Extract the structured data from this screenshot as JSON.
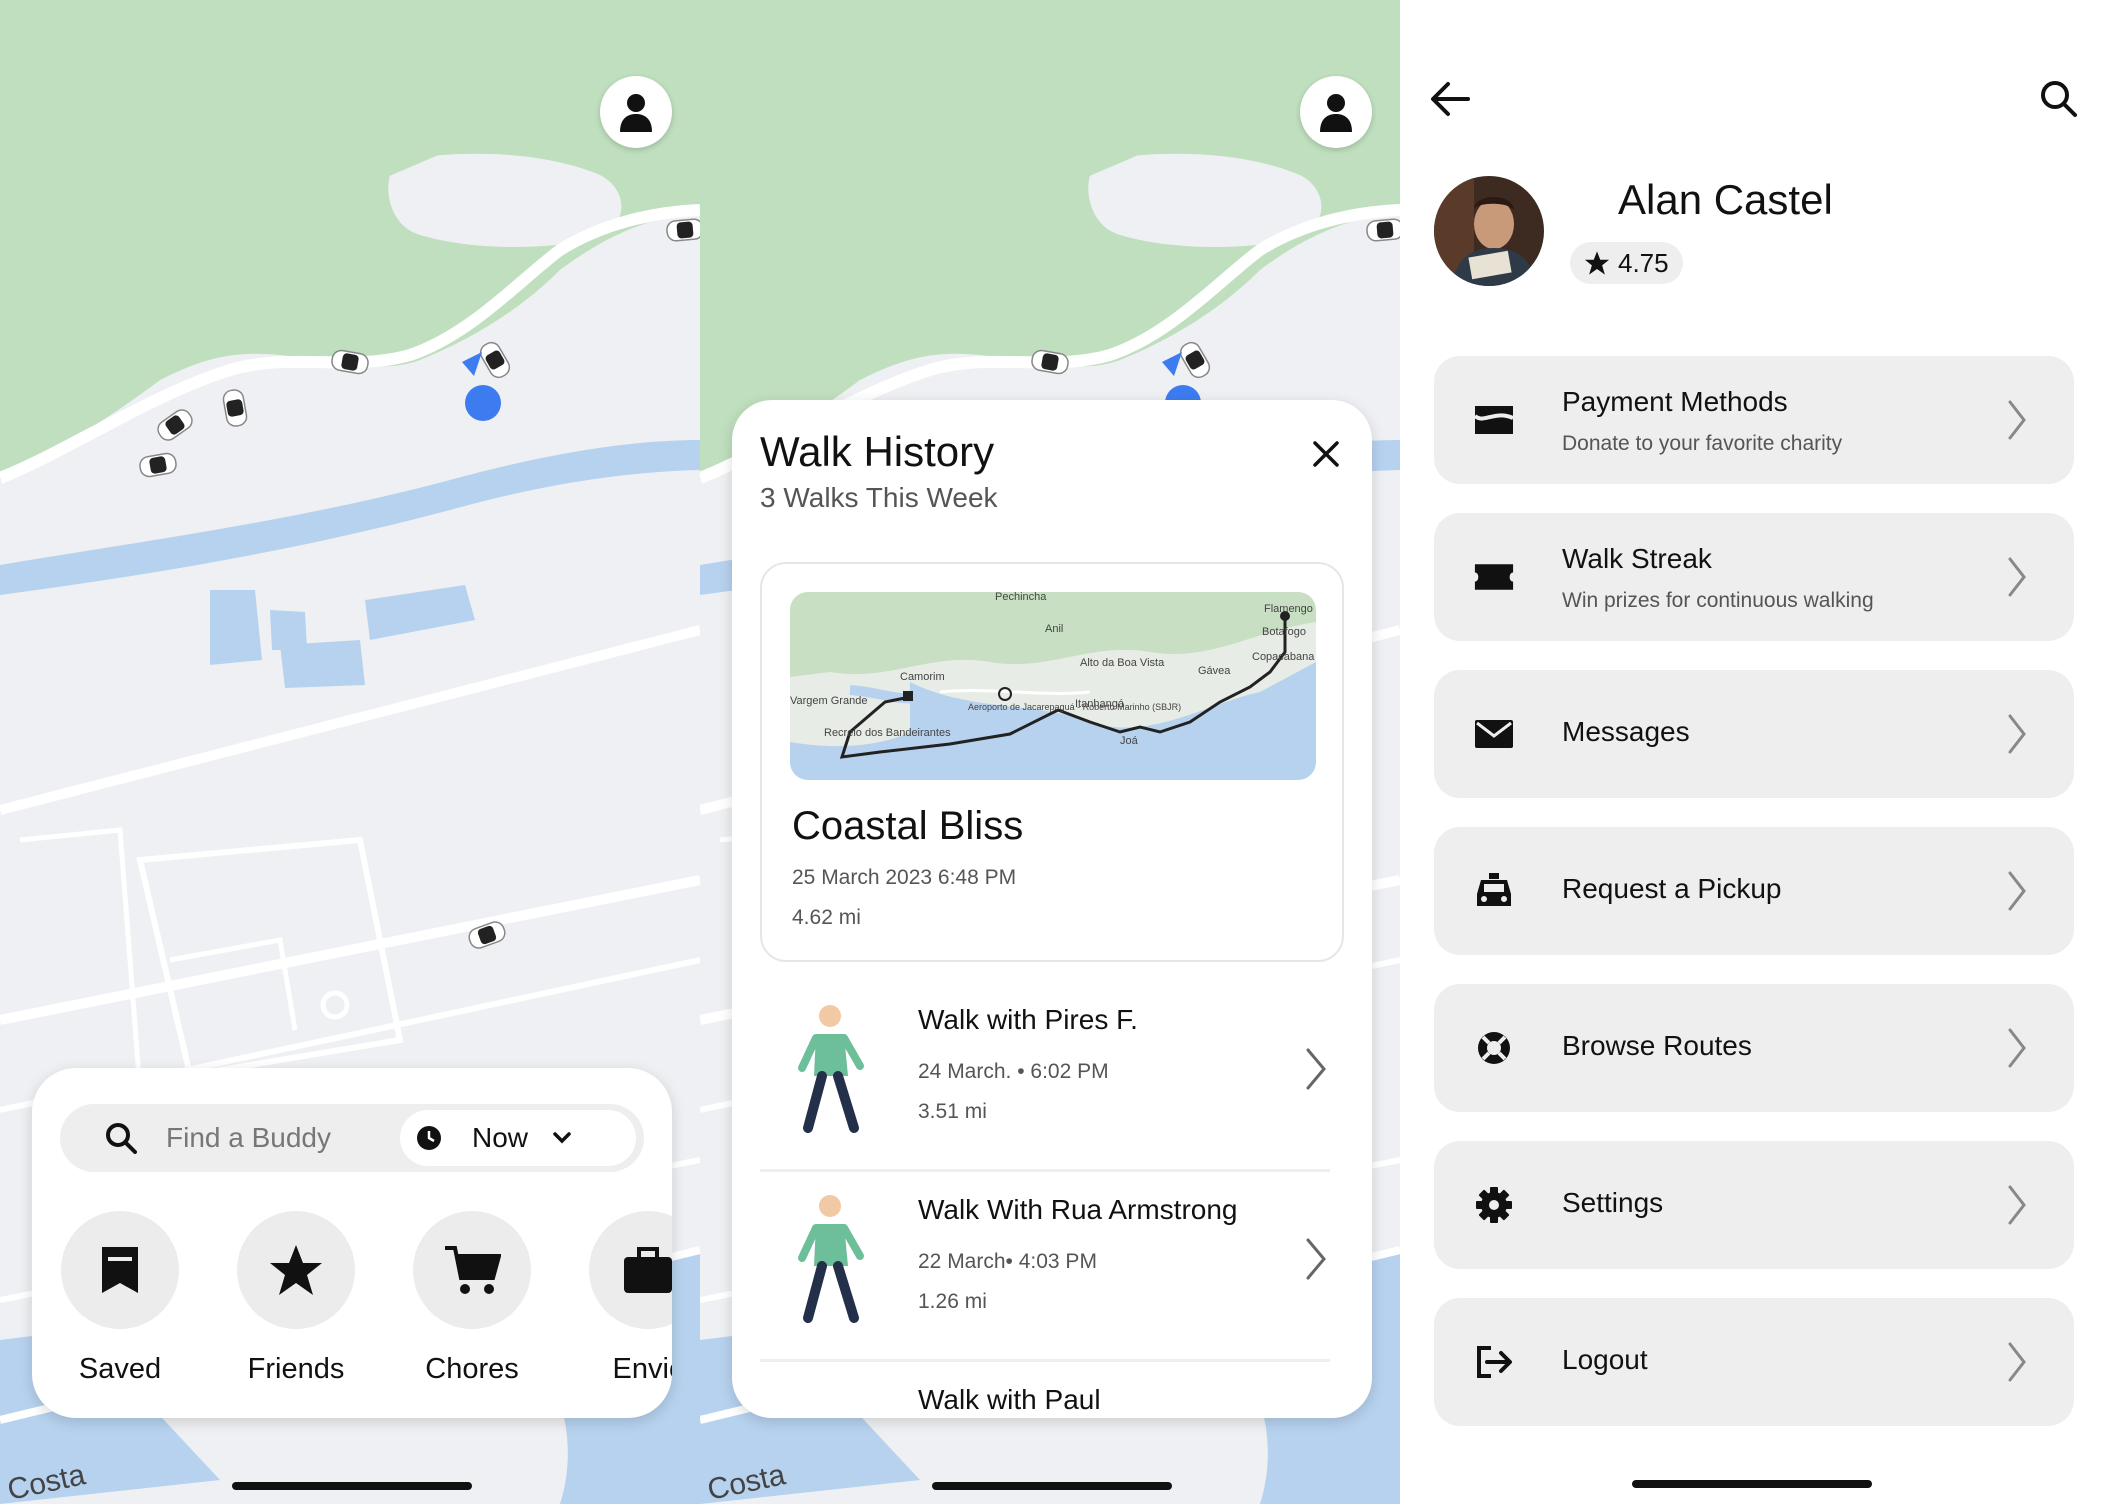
{
  "colors": {
    "map_green": "#bfdfbe",
    "map_land": "#eef0f3",
    "map_water": "#b7d2ef",
    "user_dot": "#3d7cf0",
    "card_gray": "#eeeeee"
  },
  "map": {
    "street_label": "Costa",
    "icons": {
      "profile": "person-icon",
      "car": "car-icon",
      "location": "location-dot-icon"
    }
  },
  "screen1": {
    "search_placeholder": "Find a Buddy",
    "time_label": "Now",
    "shortcuts": [
      {
        "label": "Saved",
        "icon": "bookmark-icon"
      },
      {
        "label": "Friends",
        "icon": "star-icon"
      },
      {
        "label": "Chores",
        "icon": "cart-icon"
      },
      {
        "label": "Envic",
        "icon": "briefcase-icon"
      }
    ]
  },
  "screen2": {
    "title": "Walk History",
    "subtitle": "3 Walks This Week",
    "featured": {
      "title": "Coastal Bliss",
      "date": "25 March 2023  6:48 PM",
      "distance": "4.62 mi",
      "map_labels": [
        "Pechincha",
        "Anil",
        "Alto da Boa Vista",
        "Camorim",
        "Aeroporto de Jacarepaguá - Roberto Marinho (SBJR)",
        "Itanhangá",
        "Joá",
        "Gávea",
        "Copacabana",
        "Botafogo",
        "Flamengo",
        "Recreio dos Bandeirantes",
        "Vargem Grande"
      ]
    },
    "walks": [
      {
        "title": "Walk with Pires F.",
        "date": "24 March. • 6:02 PM",
        "distance": "3.51 mi"
      },
      {
        "title": "Walk With Rua Armstrong",
        "date": "22 March• 4:03 PM",
        "distance": "1.26 mi"
      },
      {
        "title": "Walk with Paul",
        "date": "",
        "distance": ""
      }
    ]
  },
  "screen3": {
    "name": "Alan Castel",
    "rating": "4.75",
    "menu": [
      {
        "label": "Payment Methods",
        "sublabel": "Donate to your favorite charity",
        "icon": "payment-icon"
      },
      {
        "label": "Walk Streak",
        "sublabel": "Win prizes for continuous walking",
        "icon": "ticket-icon"
      },
      {
        "label": "Messages",
        "sublabel": "",
        "icon": "mail-icon"
      },
      {
        "label": "Request a Pickup",
        "sublabel": "",
        "icon": "taxi-icon"
      },
      {
        "label": "Browse Routes",
        "sublabel": "",
        "icon": "lifebuoy-icon"
      },
      {
        "label": "Settings",
        "sublabel": "",
        "icon": "gear-icon"
      },
      {
        "label": "Logout",
        "sublabel": "",
        "icon": "logout-icon"
      }
    ]
  }
}
